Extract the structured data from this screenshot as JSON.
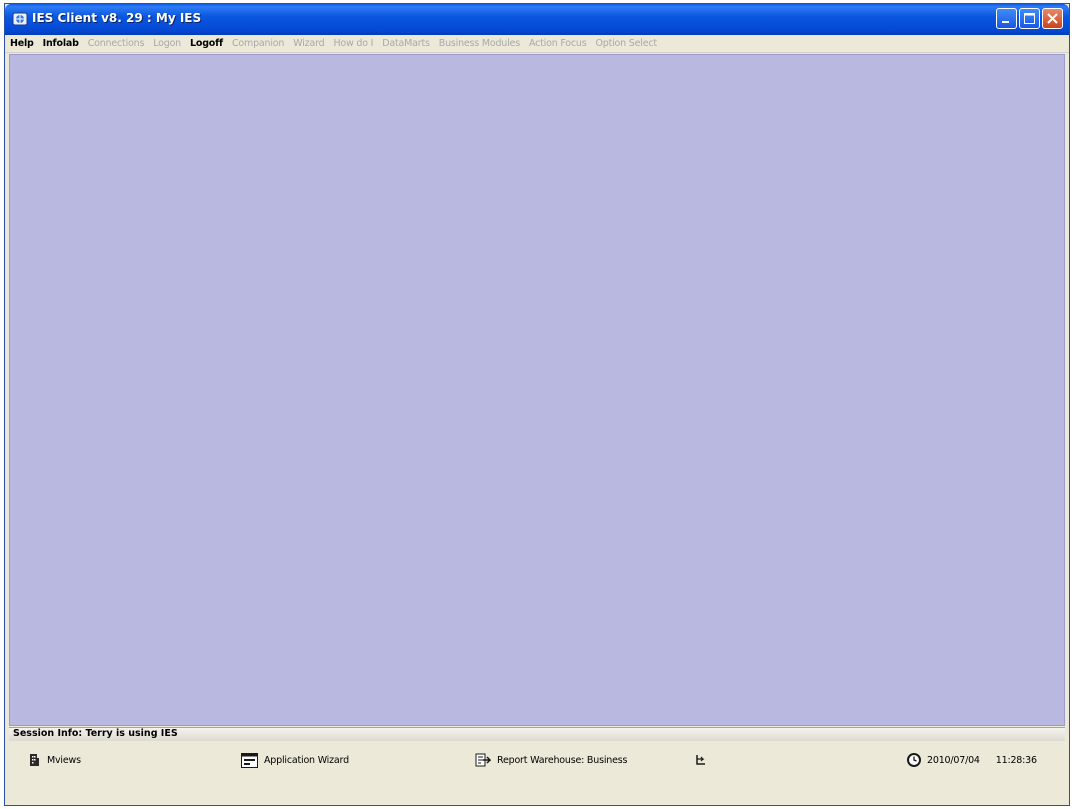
{
  "window": {
    "title": "IES Client v8. 29 : My IES"
  },
  "menu": {
    "items": [
      {
        "label": "Help",
        "enabled": true
      },
      {
        "label": "Infolab",
        "enabled": true
      },
      {
        "label": "Connections",
        "enabled": false
      },
      {
        "label": "Logon",
        "enabled": false
      },
      {
        "label": "Logoff",
        "enabled": true
      },
      {
        "label": "Companion",
        "enabled": false
      },
      {
        "label": "Wizard",
        "enabled": false
      },
      {
        "label": "How do I",
        "enabled": false
      },
      {
        "label": "DataMarts",
        "enabled": false
      },
      {
        "label": "Business Modules",
        "enabled": false
      },
      {
        "label": "Action Focus",
        "enabled": false
      },
      {
        "label": "Option Select",
        "enabled": false
      }
    ]
  },
  "session": {
    "text": "Session Info: Terry is using IES"
  },
  "toolbar": {
    "mviews_label": "Mviews",
    "app_wizard_label": "Application Wizard",
    "report_label": "Report Warehouse: Business",
    "date": "2010/07/04",
    "time": "11:28:36"
  },
  "colors": {
    "titlebar": "#0b57df",
    "workspace": "#b9b8e0",
    "chrome": "#ece9d8",
    "close_button": "#c9421d"
  },
  "icons": {
    "app": "ies-app-icon",
    "mviews": "building-icon",
    "app_wizard": "window-app-icon",
    "report": "report-arrow-icon",
    "navigate": "navigate-arrow-icon",
    "clock": "clock-icon"
  }
}
